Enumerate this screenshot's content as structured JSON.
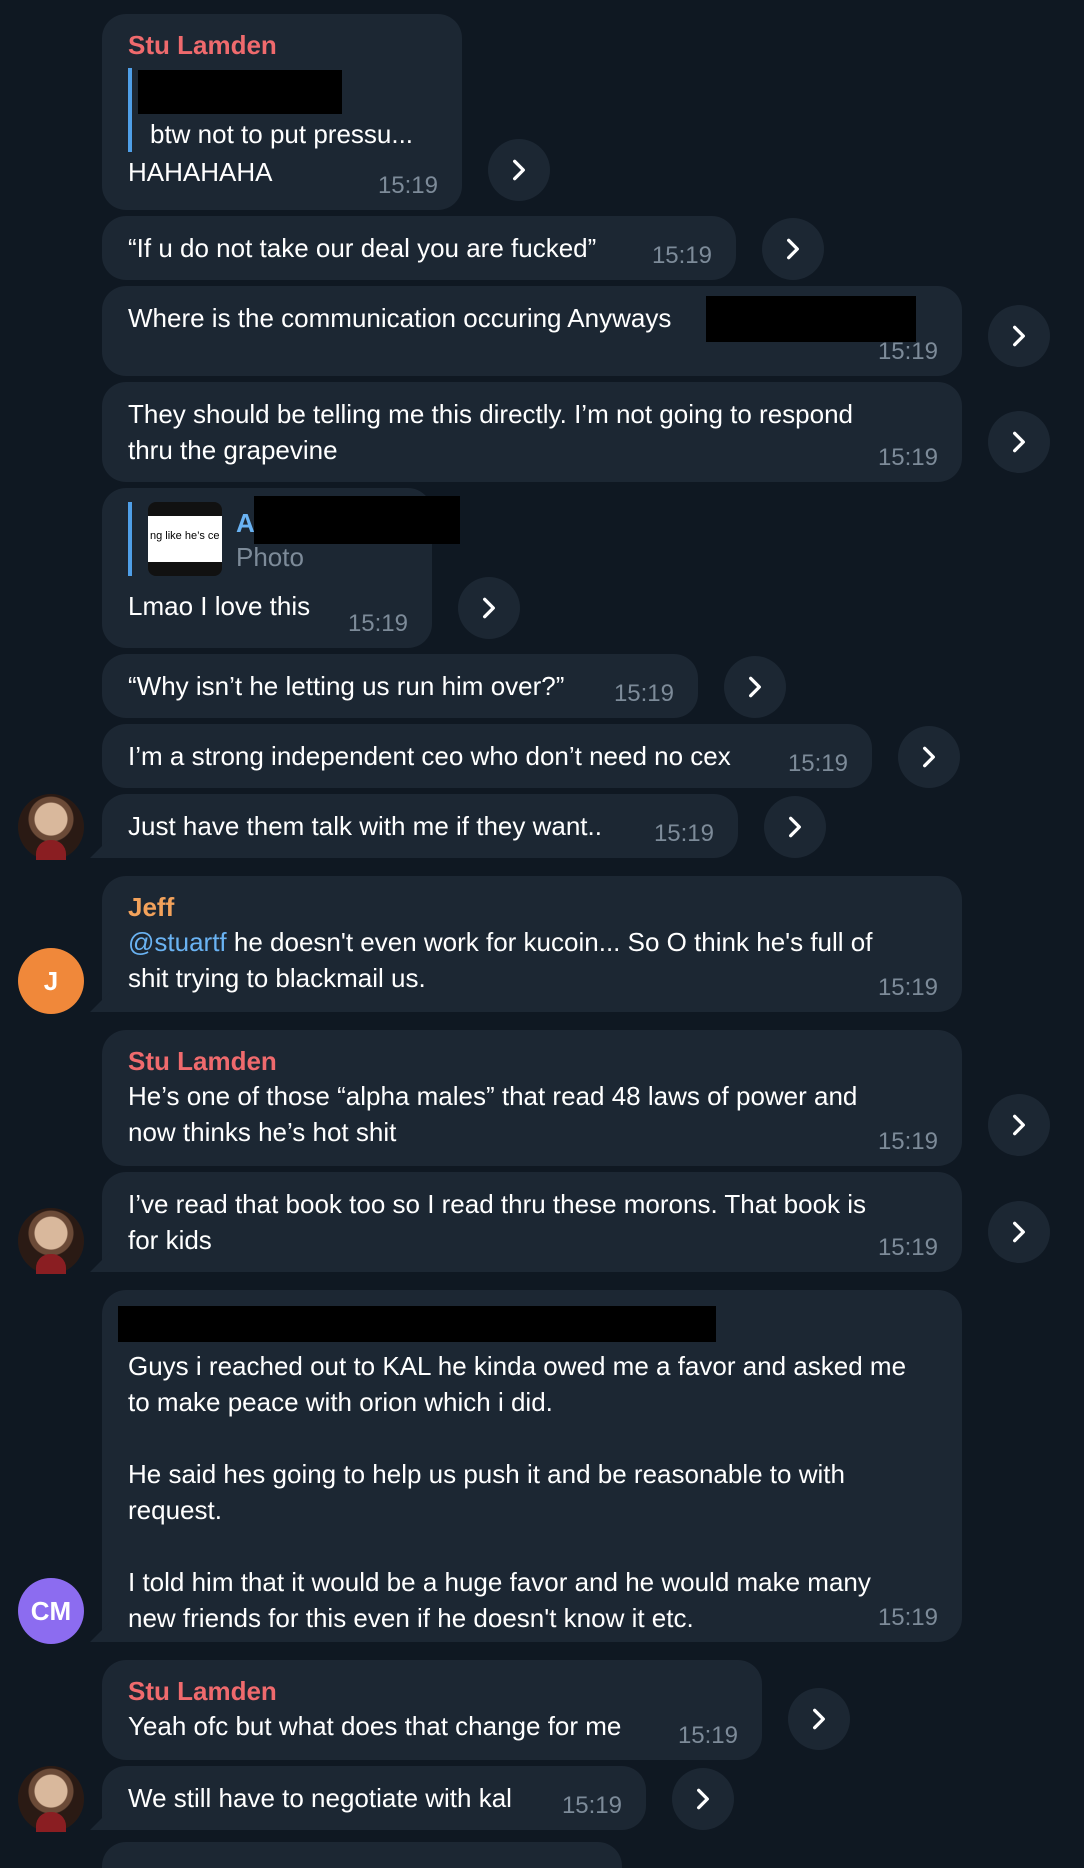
{
  "colors": {
    "background": "#0f1822",
    "bubble": "#1c2733",
    "sender_stu": "#ef6a6d",
    "sender_jeff": "#f3a25b",
    "mention": "#6ab3f3",
    "timestamp": "#7d8b99",
    "reply_bar": "#4f9fe8"
  },
  "messages": [
    {
      "sender": "Stu Lamden",
      "reply_text": "btw not to put pressu...",
      "text": "HAHAHAHA",
      "time": "15:19"
    },
    {
      "text": "“If u do not take our deal you are fucked”",
      "time": "15:19"
    },
    {
      "text": "Where is the communication occuring Anyways",
      "time": "15:19"
    },
    {
      "text": "They should be telling me this directly. I’m not going to respond thru the grapevine",
      "line1": "They should be telling me this directly. I’m not going to respond",
      "line2": "thru the grapevine",
      "time": "15:19"
    },
    {
      "reply_author": "A",
      "reply_type": "Photo",
      "reply_thumb_text": "ng like he’s ce",
      "text": "Lmao I love this",
      "time": "15:19"
    },
    {
      "text": "“Why isn’t he letting us run him over?”",
      "time": "15:19"
    },
    {
      "text": "I’m a strong independent ceo who don’t need no cex",
      "time": "15:19"
    },
    {
      "text": "Just have them talk with me if they want..",
      "time": "15:19"
    },
    {
      "sender": "Jeff",
      "mention": "@stuartf",
      "line1_rest": " he doesn't even work for kucoin... So O think he's full of",
      "line2": "shit trying to blackmail us.",
      "time": "15:19"
    },
    {
      "sender": "Stu Lamden",
      "line1": "He’s one of those “alpha males” that read 48 laws of power and",
      "line2": "now thinks he’s hot shit",
      "time": "15:19"
    },
    {
      "line1": "I’ve read that book too so I read thru these morons. That book is",
      "line2": "for kids",
      "time": "15:19"
    },
    {
      "p1_line1": "Guys i reached out to KAL he kinda owed me a favor and asked me",
      "p1_line2": "to make peace with orion which i did.",
      "p2_line1": "He said hes going to help us push it and be reasonable to with",
      "p2_line2": "request.",
      "p3_line1": "I told him that it would be a huge favor and he would make many",
      "p3_line2": "new friends for this even if he doesn't know it etc.",
      "time": "15:19"
    },
    {
      "sender": "Stu Lamden",
      "text": "Yeah ofc but what does that change for me",
      "time": "15:19"
    },
    {
      "text": "We still have to negotiate with kal",
      "time": "15:19"
    }
  ],
  "avatars": {
    "jeff_initial": "J",
    "cm_initials": "CM",
    "jeff_color": "#f0883a",
    "cm_color": "#8c6cf0"
  },
  "icons": {
    "forward": "chevron-right-icon"
  }
}
